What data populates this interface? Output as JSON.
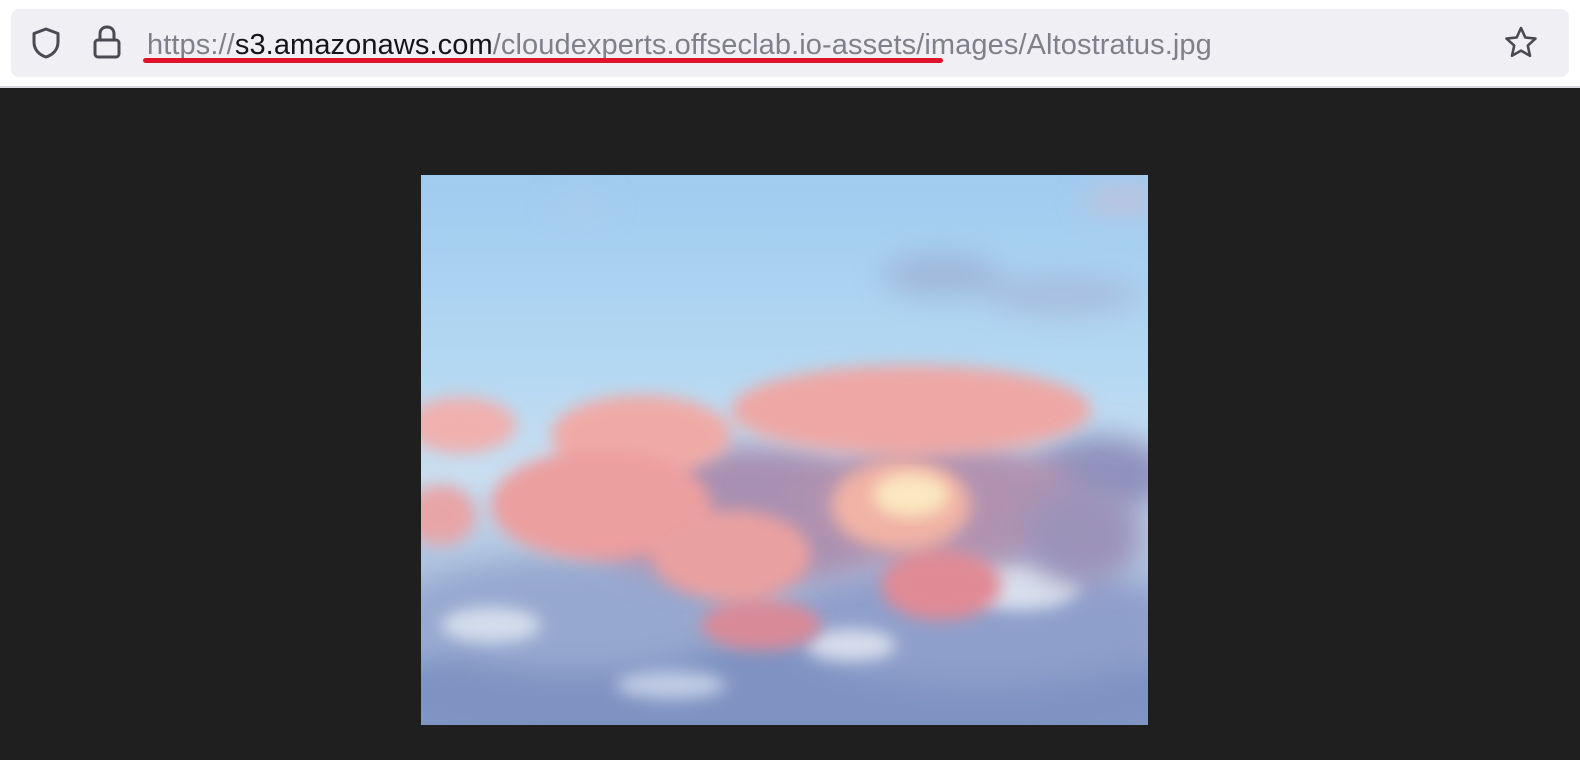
{
  "browser": {
    "address_bar": {
      "url_scheme": "https://",
      "url_host": "s3.amazonaws.com",
      "url_path": "/cloudexperts.offseclab.io-assets/images/Altostratus.jpg"
    },
    "icons": {
      "tracking_protection": "shield-icon",
      "site_security": "lock-icon",
      "bookmark": "star-icon"
    },
    "colors": {
      "page_background": "#1f1f1f",
      "url_underline": "#e0132d",
      "url_host": "#15141a",
      "url_dim": "#80808a"
    }
  },
  "content": {
    "image_subject": "pink-tinted clouds in a blue sky"
  }
}
